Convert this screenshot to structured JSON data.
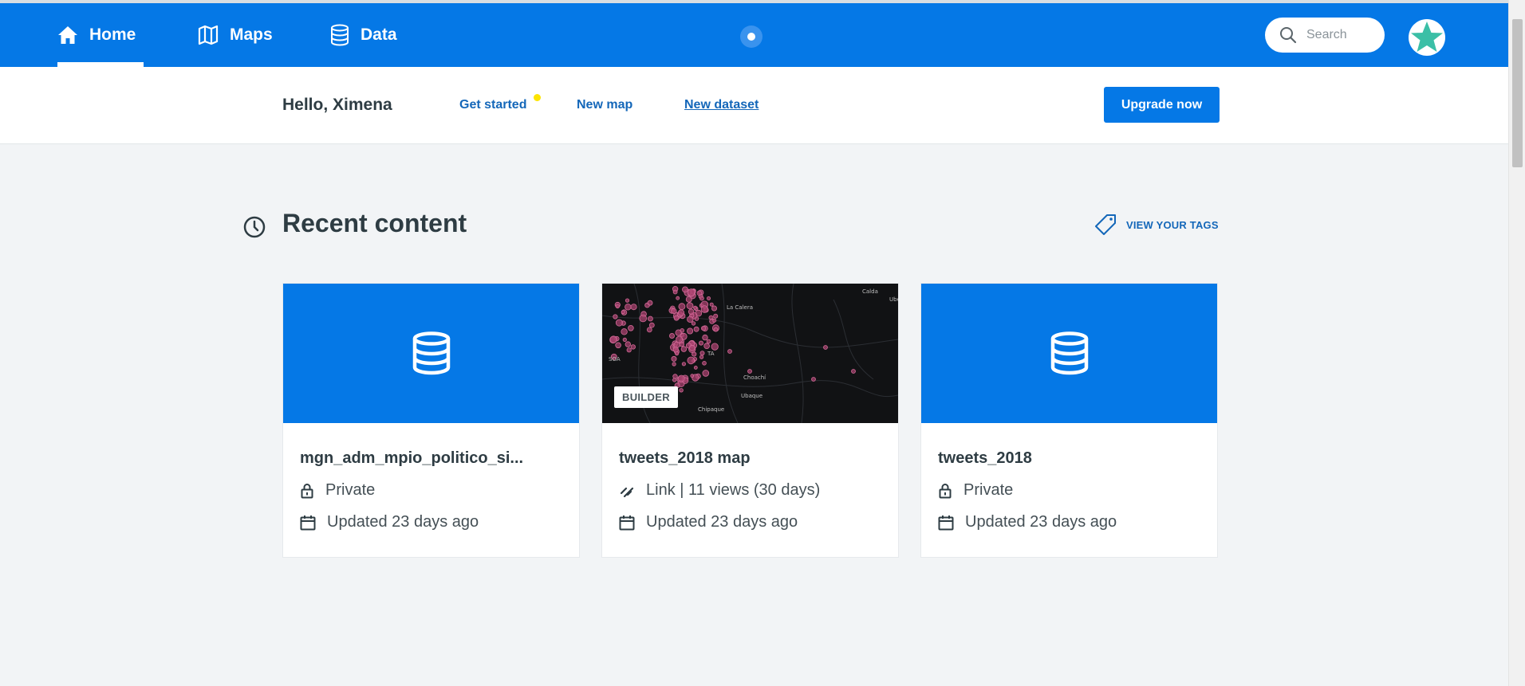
{
  "nav": {
    "home": "Home",
    "maps": "Maps",
    "data": "Data",
    "search_placeholder": "Search"
  },
  "subheader": {
    "greeting": "Hello, Ximena",
    "get_started": "Get started",
    "new_map": "New map",
    "new_dataset": "New dataset",
    "upgrade": "Upgrade now"
  },
  "section": {
    "title": "Recent content",
    "tags_link": "VIEW YOUR TAGS"
  },
  "cards": [
    {
      "title": "mgn_adm_mpio_politico_si...",
      "visibility": "Private",
      "updated": "Updated 23 days ago"
    },
    {
      "title": "tweets_2018 map",
      "badge": "BUILDER",
      "visibility": "Link | 11 views (30 days)",
      "updated": "Updated 23 days ago",
      "map_labels": [
        "Calda",
        "La Calera",
        "SOA",
        "TA",
        "Chipaque",
        "Ubaque",
        "Choachí",
        "Ube"
      ]
    },
    {
      "title": "tweets_2018",
      "visibility": "Private",
      "updated": "Updated 23 days ago"
    }
  ],
  "colors": {
    "brand": "#0578e6",
    "link": "#1467b9",
    "notification": "#fde400"
  }
}
